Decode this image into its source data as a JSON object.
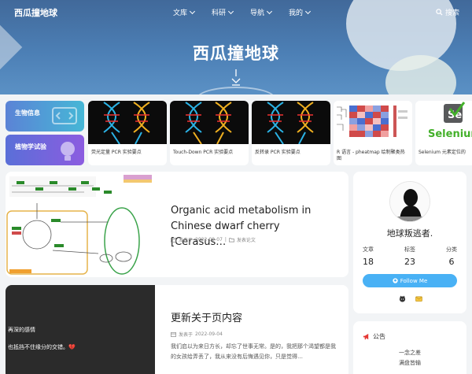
{
  "header": {
    "logo": "西瓜撞地球",
    "nav": [
      {
        "label": "文库"
      },
      {
        "label": "科研"
      },
      {
        "label": "导航"
      },
      {
        "label": "我的"
      }
    ],
    "search_label": "搜索",
    "hero_title": "西瓜撞地球"
  },
  "categories": [
    {
      "label": "生物信息",
      "icon": "code-window-icon"
    },
    {
      "label": "植物学试验",
      "icon": "lightbulb-icon"
    }
  ],
  "featured": [
    {
      "title": "荧光定量 PCR 实验要点"
    },
    {
      "title": "Touch-Down PCR 实验要点"
    },
    {
      "title": "反转录 PCR 实验要点"
    },
    {
      "title": "R 语言 - pheatmap 绘制聚类热图"
    },
    {
      "title": "Selenium 元素定位的"
    }
  ],
  "posts": [
    {
      "title": "Organic acid metabolism in Chinese dwarf cherry [Cerasus…",
      "meta_prefix": "发表于",
      "date": "2022-09-07",
      "separator": "|",
      "category": "发表论文"
    },
    {
      "title": "更新关于页内容",
      "meta_prefix": "发表于",
      "date": "2022-09-04",
      "excerpt": "我们启以为来日方长，却忘了世事无常。是的，我把那个渴望都是我的女孩给弄丢了，我从来没有后悔遇见你，只是觉得…",
      "image_lines": [
        "再深的感情",
        "也抵挡不住缘分的交错。💔"
      ]
    }
  ],
  "profile": {
    "name": "地球叛逃者.",
    "stats": [
      {
        "label": "文章",
        "value": "18"
      },
      {
        "label": "标签",
        "value": "23"
      },
      {
        "label": "分类",
        "value": "6"
      }
    ],
    "follow_label": "Follow Me"
  },
  "notice": {
    "title": "公告",
    "lines": [
      "一念之差",
      "满盘皆输"
    ]
  },
  "selenium_logo_text": "Selenium",
  "colors": {
    "accent": "#49b1f5",
    "hero": "#4c7fb5"
  }
}
